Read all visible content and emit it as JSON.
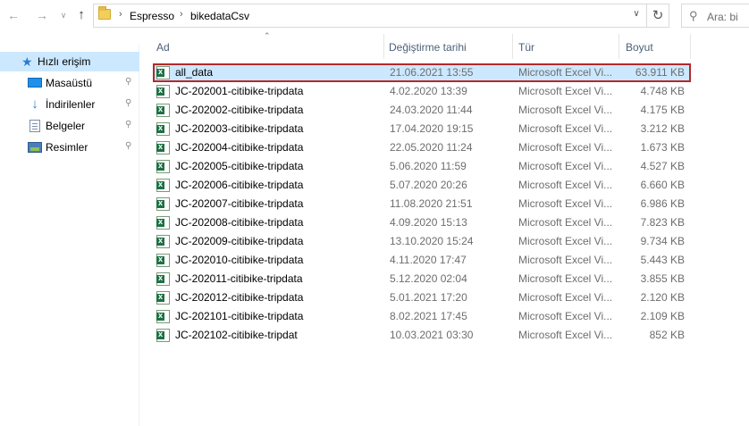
{
  "address_bar": {
    "breadcrumbs": [
      "Espresso",
      "bikedataCsv"
    ],
    "search_placeholder": "Ara: bi"
  },
  "sidebar": {
    "items": [
      {
        "label": "Hızlı erişim",
        "icon": "star-icon",
        "active": true,
        "pinned": false
      },
      {
        "label": "Masaüstü",
        "icon": "desktop-icon",
        "active": false,
        "pinned": true
      },
      {
        "label": "İndirilenler",
        "icon": "download-icon",
        "active": false,
        "pinned": true
      },
      {
        "label": "Belgeler",
        "icon": "documents-icon",
        "active": false,
        "pinned": true
      },
      {
        "label": "Resimler",
        "icon": "pictures-icon",
        "active": false,
        "pinned": true
      }
    ]
  },
  "columns": {
    "name": "Ad",
    "date": "Değiştirme tarihi",
    "type": "Tür",
    "size": "Boyut"
  },
  "files": [
    {
      "name": "all_data",
      "date": "21.06.2021 13:55",
      "type": "Microsoft Excel Vi...",
      "size": "63.911 KB",
      "selected": true
    },
    {
      "name": "JC-202001-citibike-tripdata",
      "date": "4.02.2020 13:39",
      "type": "Microsoft Excel Vi...",
      "size": "4.748 KB"
    },
    {
      "name": "JC-202002-citibike-tripdata",
      "date": "24.03.2020 11:44",
      "type": "Microsoft Excel Vi...",
      "size": "4.175 KB"
    },
    {
      "name": "JC-202003-citibike-tripdata",
      "date": "17.04.2020 19:15",
      "type": "Microsoft Excel Vi...",
      "size": "3.212 KB"
    },
    {
      "name": "JC-202004-citibike-tripdata",
      "date": "22.05.2020 11:24",
      "type": "Microsoft Excel Vi...",
      "size": "1.673 KB"
    },
    {
      "name": "JC-202005-citibike-tripdata",
      "date": "5.06.2020 11:59",
      "type": "Microsoft Excel Vi...",
      "size": "4.527 KB"
    },
    {
      "name": "JC-202006-citibike-tripdata",
      "date": "5.07.2020 20:26",
      "type": "Microsoft Excel Vi...",
      "size": "6.660 KB"
    },
    {
      "name": "JC-202007-citibike-tripdata",
      "date": "11.08.2020 21:51",
      "type": "Microsoft Excel Vi...",
      "size": "6.986 KB"
    },
    {
      "name": "JC-202008-citibike-tripdata",
      "date": "4.09.2020 15:13",
      "type": "Microsoft Excel Vi...",
      "size": "7.823 KB"
    },
    {
      "name": "JC-202009-citibike-tripdata",
      "date": "13.10.2020 15:24",
      "type": "Microsoft Excel Vi...",
      "size": "9.734 KB"
    },
    {
      "name": "JC-202010-citibike-tripdata",
      "date": "4.11.2020 17:47",
      "type": "Microsoft Excel Vi...",
      "size": "5.443 KB"
    },
    {
      "name": "JC-202011-citibike-tripdata",
      "date": "5.12.2020 02:04",
      "type": "Microsoft Excel Vi...",
      "size": "3.855 KB"
    },
    {
      "name": "JC-202012-citibike-tripdata",
      "date": "5.01.2021 17:20",
      "type": "Microsoft Excel Vi...",
      "size": "2.120 KB"
    },
    {
      "name": "JC-202101-citibike-tripdata",
      "date": "8.02.2021 17:45",
      "type": "Microsoft Excel Vi...",
      "size": "2.109 KB"
    },
    {
      "name": "JC-202102-citibike-tripdat",
      "date": "10.03.2021 03:30",
      "type": "Microsoft Excel Vi...",
      "size": "852 KB"
    }
  ],
  "colors": {
    "selection_bg": "#cce8ff",
    "highlight_border": "#b22a2a",
    "header_text": "#4c607a",
    "excel_green": "#1e7145"
  }
}
